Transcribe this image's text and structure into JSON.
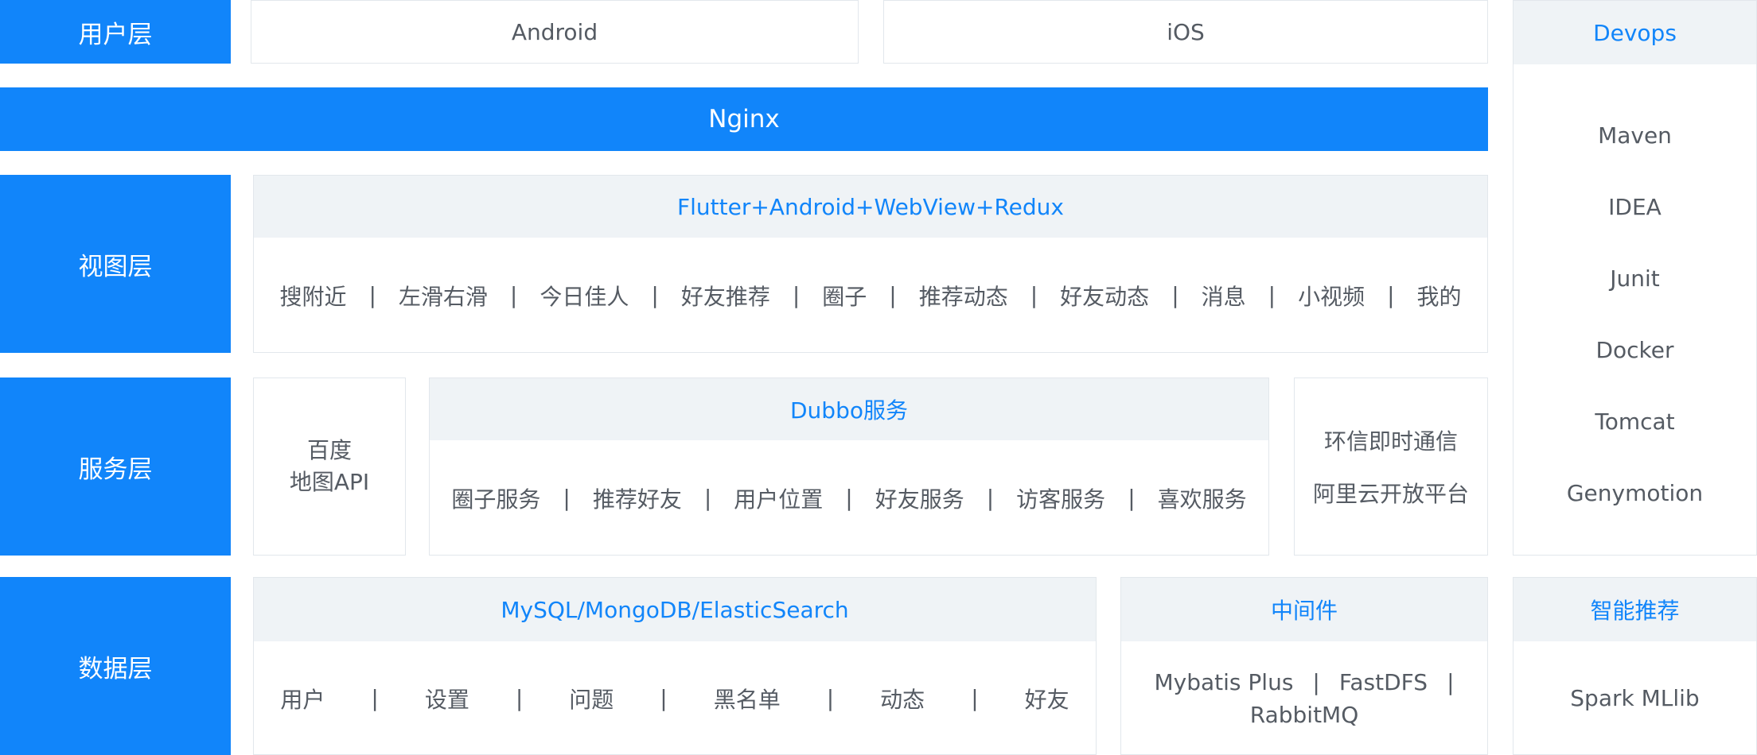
{
  "layers": {
    "user": "用户层",
    "view": "视图层",
    "service": "服务层",
    "data": "数据层"
  },
  "user_layer": {
    "android": "Android",
    "ios": "iOS"
  },
  "gateway": "Nginx",
  "view_layer": {
    "title": "Flutter+Android+WebView+Redux",
    "items": [
      "搜附近",
      "左滑右滑",
      "今日佳人",
      "好友推荐",
      "圈子",
      "推荐动态",
      "好友动态",
      "消息",
      "小视频",
      "我的"
    ]
  },
  "service_layer": {
    "baidu_line1": "百度",
    "baidu_line2": "地图API",
    "dubbo_title": "Dubbo服务",
    "dubbo_items": [
      "圈子服务",
      "推荐好友",
      "用户位置",
      "好友服务",
      "访客服务",
      "喜欢服务"
    ],
    "im_line1": "环信即时通信",
    "im_line2": "阿里云开放平台"
  },
  "data_layer": {
    "db_title": "MySQL/MongoDB/ElasticSearch",
    "db_items": [
      "用户",
      "设置",
      "问题",
      "黑名单",
      "动态",
      "好友"
    ],
    "middleware_title": "中间件",
    "middleware_line1": [
      "Mybatis Plus",
      "FastDFS",
      ""
    ],
    "middleware_line2": "RabbitMQ",
    "ai_title": "智能推荐",
    "ai_item": "Spark MLlib"
  },
  "devops": {
    "title": "Devops",
    "items": [
      "Maven",
      "IDEA",
      "Junit",
      "Docker",
      "Tomcat",
      "Genymotion"
    ]
  },
  "separator": "|",
  "colors": {
    "primary": "#1185fa",
    "header_bg": "#eff3f6",
    "border": "#e2e7ec",
    "text": "#555b63"
  }
}
